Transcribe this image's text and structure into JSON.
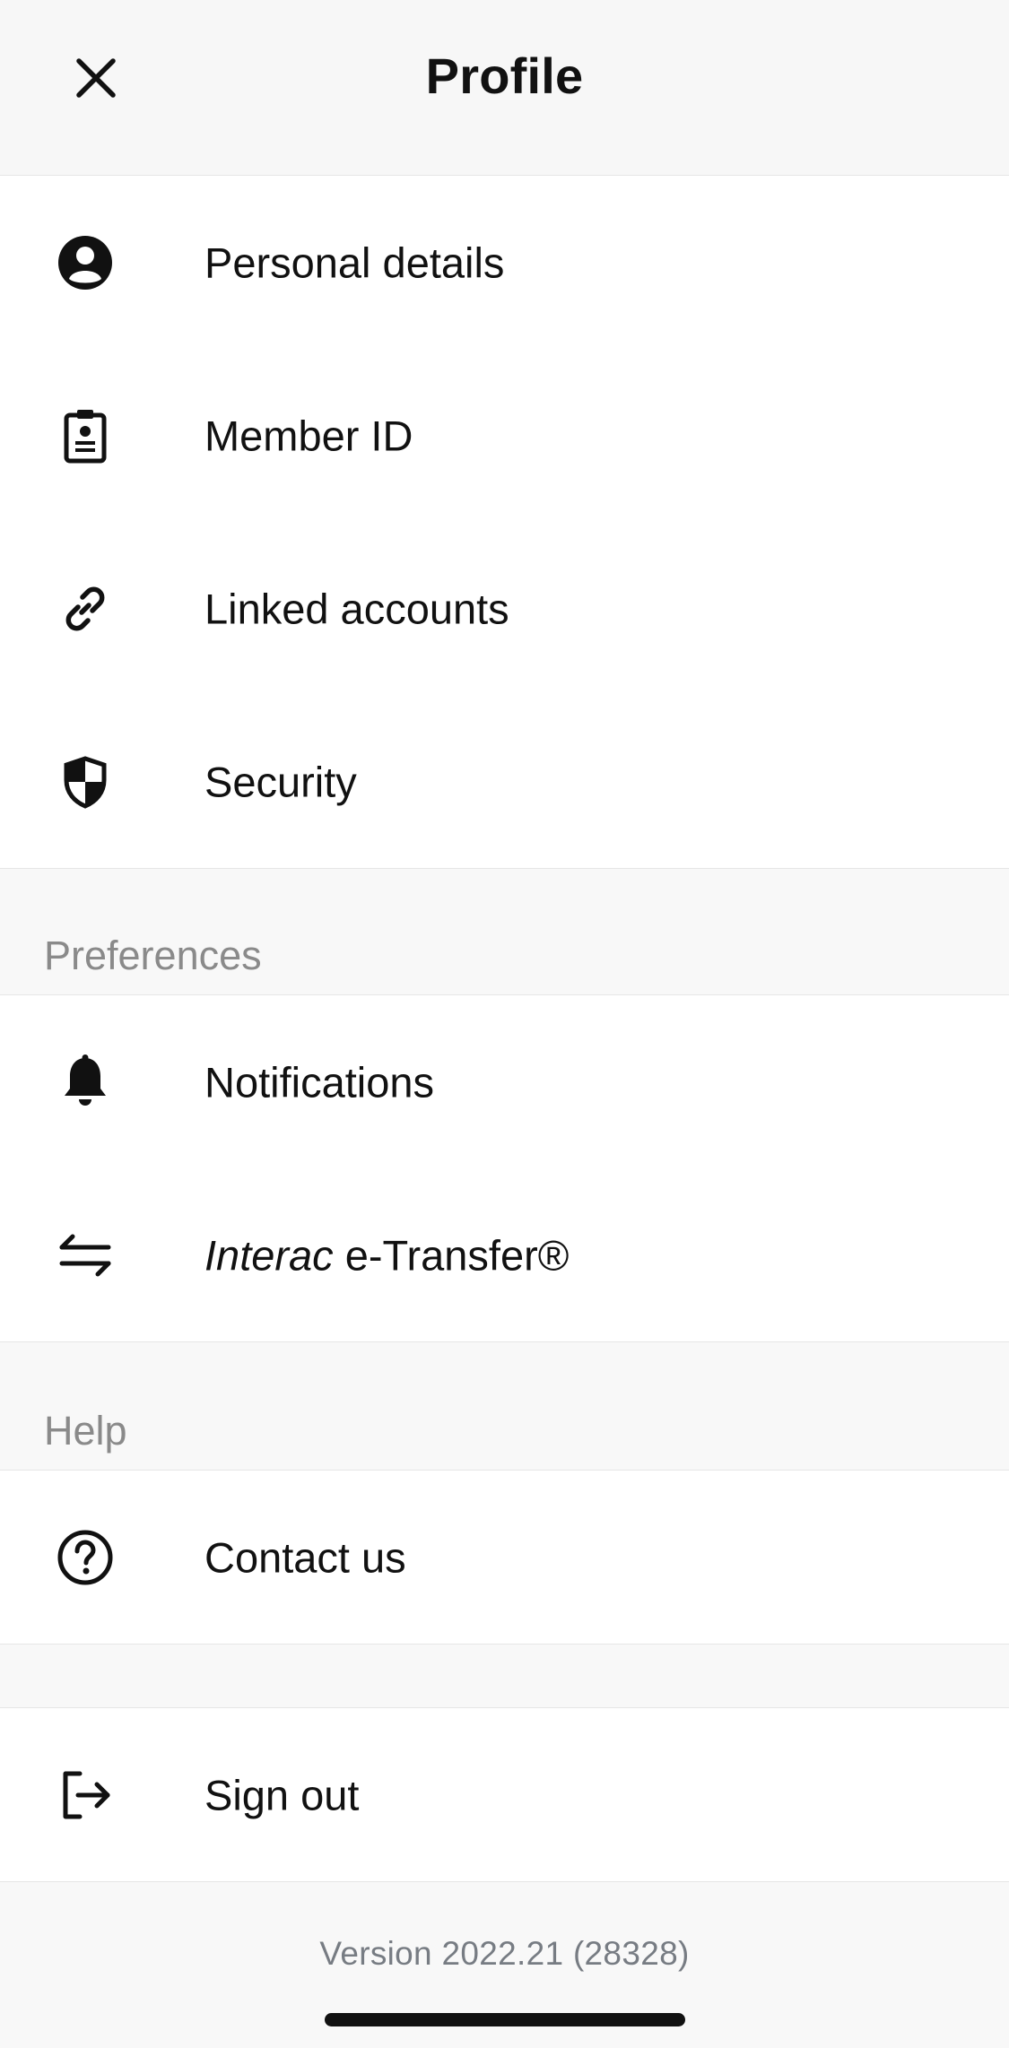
{
  "header": {
    "title": "Profile",
    "close_icon": "close-icon"
  },
  "account_items": [
    {
      "label": "Personal details",
      "icon": "person-circle-icon"
    },
    {
      "label": "Member ID",
      "icon": "badge-icon"
    },
    {
      "label": "Linked accounts",
      "icon": "link-icon"
    },
    {
      "label": "Security",
      "icon": "shield-icon"
    }
  ],
  "preferences": {
    "heading": "Preferences",
    "items": [
      {
        "label": "Notifications",
        "icon": "bell-icon"
      },
      {
        "label_italic": "Interac",
        "label_rest": " e-Transfer®",
        "icon": "transfer-arrows-icon"
      }
    ]
  },
  "help": {
    "heading": "Help",
    "items": [
      {
        "label": "Contact us",
        "icon": "question-circle-icon"
      }
    ]
  },
  "signout": {
    "label": "Sign out",
    "icon": "sign-out-icon"
  },
  "footer": {
    "version": "Version 2022.21 (28328)"
  },
  "colors": {
    "background": "#f8f8f8",
    "surface": "#ffffff",
    "text": "#111111",
    "muted": "#8a8a8a"
  }
}
